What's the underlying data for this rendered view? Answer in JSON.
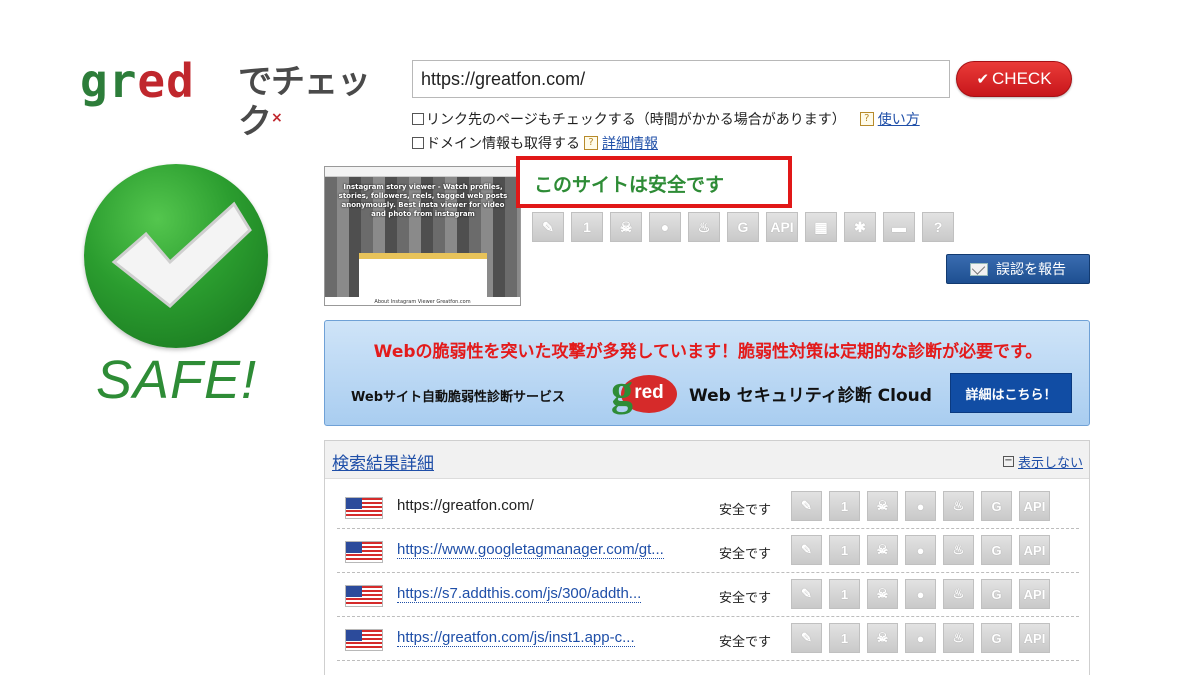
{
  "logo": {
    "brand_part1": "gr",
    "brand_part2": "ed",
    "suffix": "でチェック",
    "suffix_mark": "×"
  },
  "search": {
    "url_value": "https://greatfon.com/",
    "check_label": "CHECK"
  },
  "options": [
    {
      "label": "リンク先のページもチェックする（時間がかかる場合があります）",
      "link": "使い方"
    },
    {
      "label": "ドメイン情報も取得する",
      "link": "詳細情報"
    }
  ],
  "badge": {
    "safe_text": "SAFE!"
  },
  "thumbnail": {
    "title": "Instagram story viewer - Watch profiles, stories, followers, reels, tagged web posts anonymously. Best insta viewer for video and photo from instagram",
    "footer": "About Instagram Viewer Greatfon.com"
  },
  "result": {
    "verdict": "このサイトは安全です",
    "threat_icons": [
      "fake-site-icon",
      "one-click-fraud-icon",
      "skull-icon",
      "drop-icon",
      "fire-icon",
      "g-icon",
      "api-icon",
      "qr-icon",
      "bug-icon",
      "gun-icon",
      "unknown-icon"
    ],
    "threat_icon_glyphs": [
      "✎",
      "1",
      "☠",
      "●",
      "♨",
      "G",
      "API",
      "▦",
      "✱",
      "▬",
      "?"
    ],
    "report_label": "誤認を報告"
  },
  "banner": {
    "headline": "Webの脆弱性を突いた攻撃が多発しています！脆弱性対策は定期的な診断が必要です。",
    "service": "Webサイト自動脆弱性診断サービス",
    "logo_g": "g",
    "logo_red": "red",
    "product": "Web セキュリティ診断 Cloud",
    "button": "詳細はこちら！"
  },
  "results": {
    "title": "検索結果詳細",
    "toggle": "表示しない",
    "row_icon_glyphs": [
      "✎",
      "1",
      "☠",
      "●",
      "♨",
      "G",
      "API"
    ],
    "rows": [
      {
        "url": "https://greatfon.com/",
        "status": "安全です"
      },
      {
        "url": "https://www.googletagmanager.com/gt...",
        "status": "安全です"
      },
      {
        "url": "https://s7.addthis.com/js/300/addth...",
        "status": "安全です"
      },
      {
        "url": "https://greatfon.com/js/inst1.app-c...",
        "status": "安全です"
      }
    ]
  }
}
